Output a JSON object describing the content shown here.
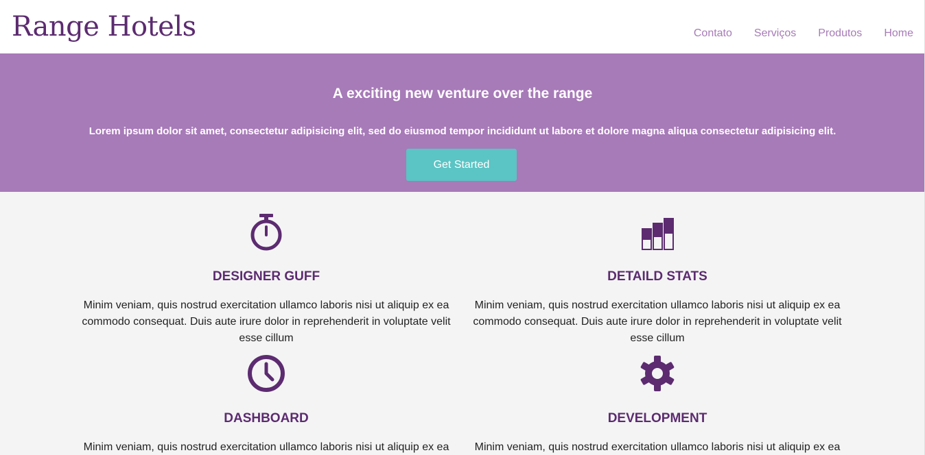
{
  "header": {
    "logo": "Range Hotels",
    "nav": [
      {
        "label": "Contato"
      },
      {
        "label": "Serviços"
      },
      {
        "label": "Produtos"
      },
      {
        "label": "Home"
      }
    ]
  },
  "hero": {
    "title": "A exciting new venture over the range",
    "text": "Lorem ipsum dolor sit amet, consectetur adipisicing elit, sed do eiusmod tempor incididunt ut labore et dolore magna aliqua consectetur adipisicing elit.",
    "cta_label": "Get Started"
  },
  "features": [
    {
      "icon": "stopwatch-icon",
      "title": "DESIGNER GUFF",
      "text": "Minim veniam, quis nostrud exercitation ullamco laboris nisi ut aliquip ex ea commodo consequat. Duis aute irure dolor in reprehenderit in voluptate velit esse cillum"
    },
    {
      "icon": "bar-chart-icon",
      "title": "DETAILD STATS",
      "text": "Minim veniam, quis nostrud exercitation ullamco laboris nisi ut aliquip ex ea commodo consequat. Duis aute irure dolor in reprehenderit in voluptate velit esse cillum"
    },
    {
      "icon": "clock-icon",
      "title": "DASHBOARD",
      "text": "Minim veniam, quis nostrud exercitation ullamco laboris nisi ut aliquip ex ea"
    },
    {
      "icon": "gear-icon",
      "title": "DEVELOPMENT",
      "text": "Minim veniam, quis nostrud exercitation ullamco laboris nisi ut aliquip ex ea"
    }
  ],
  "colors": {
    "brand": "#5c2b70",
    "hero_bg": "#a77ab8",
    "cta_bg": "#5bc4c4",
    "page_bg": "#f4f4f4"
  }
}
